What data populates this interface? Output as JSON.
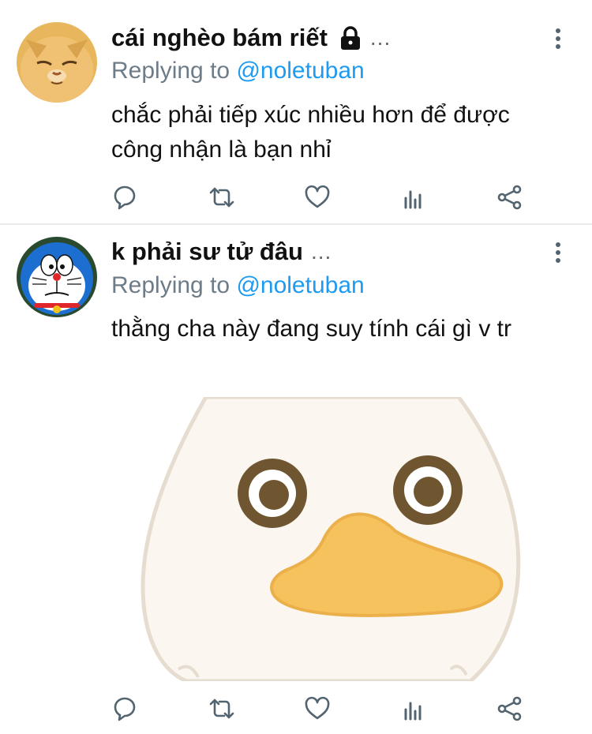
{
  "tweets": [
    {
      "display_name": "cái nghèo bám riết",
      "name_more": "...",
      "reply_prefix": "Replying to",
      "reply_handle": "@noletuban",
      "text": "chắc phải tiếp xúc nhiều hơn để được công nhận là bạn nhỉ",
      "protected": true,
      "avatar": "orange-cat-avatar"
    },
    {
      "display_name": "k phải sư tử đâu",
      "name_more": "...",
      "reply_prefix": "Replying to",
      "reply_handle": "@noletuban",
      "text": "thằng cha này đang suy tính cái gì v tr",
      "protected": false,
      "avatar": "doraemon-avatar",
      "media": "duck-face-sticker"
    }
  ],
  "colors": {
    "link": "#1d9bf0",
    "muted": "#6e7c88",
    "icon": "#536471",
    "duck_beak": "#f6c25d",
    "duck_body": "#fbf7f0"
  }
}
